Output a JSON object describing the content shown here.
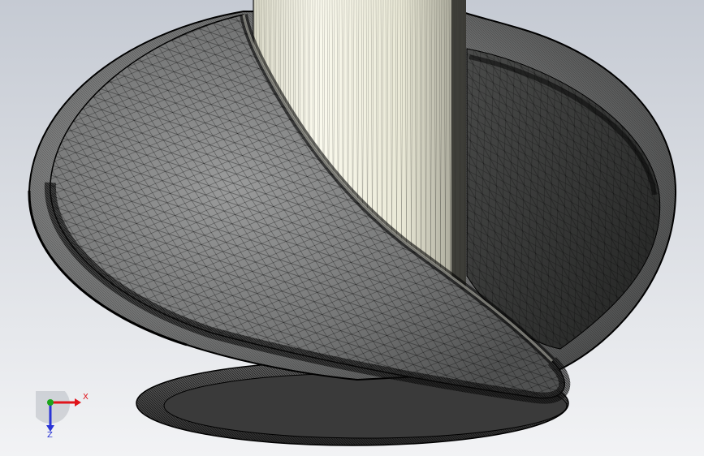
{
  "viewport": {
    "background_top": "#c5cad3",
    "background_bottom": "#f2f3f5"
  },
  "model": {
    "mesh_line_color": "#000000",
    "shaft_color": "#f6f5e8",
    "flight_color": "#6e6f6f",
    "flight_dark_color": "#3e3f3e"
  },
  "triad": {
    "x_label": "X",
    "z_label": "Z",
    "x_color": "#e0141b",
    "y_color": "#1ba51b",
    "z_color": "#2a34d6"
  }
}
